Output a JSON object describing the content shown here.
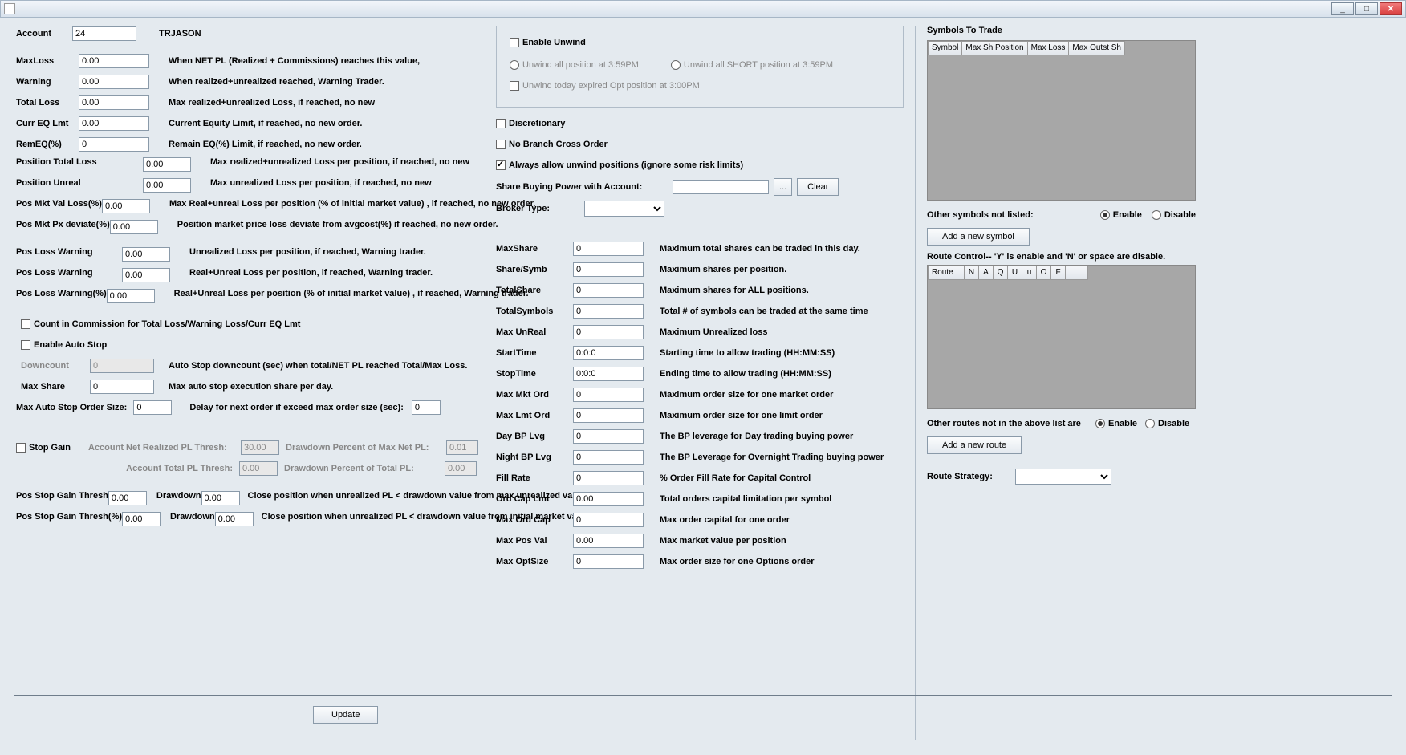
{
  "titlebar": {
    "min": "_",
    "max": "□",
    "close": "✕"
  },
  "account": {
    "label": "Account",
    "value": "24",
    "name": "TRJASON"
  },
  "col1": {
    "rows_a": [
      {
        "label": "MaxLoss",
        "value": "0.00",
        "desc": "When NET PL (Realized + Commissions) reaches this value,"
      },
      {
        "label": "Warning",
        "value": "0.00",
        "desc": "When realized+unrealized reached, Warning Trader."
      },
      {
        "label": "Total Loss",
        "value": "0.00",
        "desc": "Max realized+unrealized Loss, if reached, no new"
      },
      {
        "label": "Curr EQ Lmt",
        "value": "0.00",
        "desc": "Current Equity Limit, if reached, no new order."
      },
      {
        "label": "RemEQ(%)",
        "value": "0",
        "desc": "Remain EQ(%) Limit, if reached, no new order."
      }
    ],
    "rows_b": [
      {
        "label": "Position Total Loss",
        "value": "0.00",
        "desc": "Max realized+unrealized Loss per position, if reached, no new"
      },
      {
        "label": "Position Unreal",
        "value": "0.00",
        "desc": "Max unrealized Loss per position, if reached, no new"
      },
      {
        "label": "Pos Mkt Val Loss(%)",
        "value": "0.00",
        "desc": "Max Real+unreal Loss per position (% of initial market value) , if reached, no new order."
      },
      {
        "label": "Pos Mkt Px deviate(%)",
        "value": "0.00",
        "desc": "Position market price loss deviate from avgcost(%) if reached, no new order."
      }
    ],
    "rows_c": [
      {
        "label": "Pos Loss Warning",
        "value": "0.00",
        "desc": "Unrealized Loss per position, if reached, Warning trader."
      },
      {
        "label": "Pos Loss Warning",
        "value": "0.00",
        "desc": "Real+Unreal Loss per position, if reached, Warning trader."
      },
      {
        "label": "Pos Loss Warning(%)",
        "value": "0.00",
        "desc": "Real+Unreal Loss per position (% of initial market value) , if reached, Warning trader."
      }
    ],
    "chk_commission": "Count in Commission for Total Loss/Warning Loss/Curr EQ Lmt",
    "chk_autostop": "Enable Auto Stop",
    "downcount": {
      "label": "Downcount",
      "value": "0",
      "desc": "Auto Stop downcount (sec) when total/NET PL reached Total/Max Loss."
    },
    "maxshare": {
      "label": "Max Share",
      "value": "0",
      "desc": "Max auto stop execution share per day."
    },
    "maxautostop": {
      "label": "Max Auto Stop Order Size:",
      "value": "0",
      "delay_label": "Delay for next order if exceed max order size (sec):",
      "delay_value": "0"
    },
    "stopgain_chk": "Stop Gain",
    "acct_net_label": "Account Net Realized PL Thresh:",
    "acct_net_value": "30.00",
    "dd_maxnet_label": "Drawdown Percent of Max Net PL:",
    "dd_maxnet_value": "0.01",
    "acct_tot_label": "Account Total PL Thresh:",
    "acct_tot_value": "0.00",
    "dd_tot_label": "Drawdown Percent of Total PL:",
    "dd_tot_value": "0.00",
    "psgt": [
      {
        "label": "Pos Stop Gain Thresh",
        "v": "0.00",
        "dd_label": "Drawdown",
        "dd": "0.00",
        "desc": "Close position when unrealized PL < drawdown value from max unrealized value"
      },
      {
        "label": "Pos Stop Gain Thresh(%)",
        "v": "0.00",
        "dd_label": "Drawdown",
        "dd": "0.00",
        "desc": "Close position when unrealized PL < drawdown value from initial market value (%)"
      }
    ]
  },
  "col2": {
    "enable_unwind": "Enable Unwind",
    "unwind_all": "Unwind all position at 3:59PM",
    "unwind_short": "Unwind all SHORT position at 3:59PM",
    "unwind_opt": "Unwind today expired Opt position at 3:00PM",
    "discretionary": "Discretionary",
    "no_branch": "No Branch Cross Order",
    "always_unwind": "Always allow unwind positions (ignore some risk limits)",
    "share_bp_label": "Share Buying Power with Account:",
    "ellipsis": "...",
    "clear": "Clear",
    "broker_label": "Broker Type:",
    "rows": [
      {
        "label": "MaxShare",
        "value": "0",
        "desc": "Maximum total shares can be traded in this day."
      },
      {
        "label": "Share/Symb",
        "value": "0",
        "desc": "Maximum shares per position."
      },
      {
        "label": "TotalShare",
        "value": "0",
        "desc": "Maximum shares for ALL positions."
      },
      {
        "label": "TotalSymbols",
        "value": "0",
        "desc": "Total # of symbols can be traded at the same time"
      },
      {
        "label": "Max UnReal",
        "value": "0",
        "desc": "Maximum Unrealized loss"
      },
      {
        "label": "StartTime",
        "value": "0:0:0",
        "desc": "Starting time to allow trading (HH:MM:SS)"
      },
      {
        "label": "StopTime",
        "value": "0:0:0",
        "desc": "Ending time to allow trading (HH:MM:SS)"
      },
      {
        "label": "Max Mkt Ord",
        "value": "0",
        "desc": "Maximum order size for one market order"
      },
      {
        "label": "Max Lmt Ord",
        "value": "0",
        "desc": "Maximum order size for one limit order"
      },
      {
        "label": "Day BP Lvg",
        "value": "0",
        "desc": "The BP leverage for Day trading buying power"
      },
      {
        "label": "Night BP Lvg",
        "value": "0",
        "desc": "The BP Leverage for Overnight Trading buying power"
      },
      {
        "label": "Fill Rate",
        "value": "0",
        "desc": "% Order Fill Rate for Capital Control"
      },
      {
        "label": "Ord Cap Lmt",
        "value": "0.00",
        "desc": "Total orders capital limitation per symbol"
      },
      {
        "label": "Max Ord Cap",
        "value": "0",
        "desc": "Max order capital for one order"
      },
      {
        "label": "Max Pos Val",
        "value": "0.00",
        "desc": "Max market value per position"
      },
      {
        "label": "Max OptSize",
        "value": "0",
        "desc": "Max order size for one Options order"
      }
    ]
  },
  "col3": {
    "heading": "Symbols To Trade",
    "sym_cols": [
      "Symbol",
      "Max Sh Position",
      "Max Loss",
      "Max Outst Sh"
    ],
    "other_sym": "Other symbols not listed:",
    "enable": "Enable",
    "disable": "Disable",
    "add_sym": "Add a new symbol",
    "route_heading": "Route Control-- 'Y' is enable and 'N' or space are disable.",
    "route_cols": [
      "Route",
      "N",
      "A",
      "Q",
      "U",
      "u",
      "O",
      "F"
    ],
    "other_routes": "Other routes not in the above list are",
    "add_route": "Add a new route",
    "route_strategy": "Route Strategy:"
  },
  "update": "Update"
}
